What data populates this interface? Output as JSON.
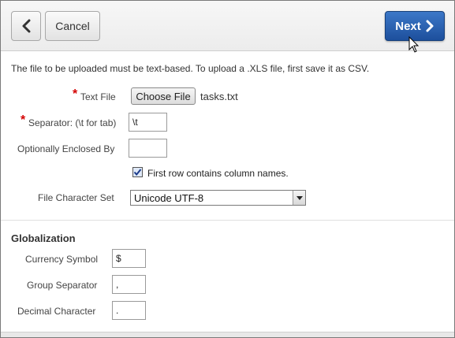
{
  "toolbar": {
    "back_icon": "chevron-left-icon",
    "cancel_label": "Cancel",
    "next_label": "Next",
    "next_icon": "chevron-right-icon",
    "accent_color": "#1d4f9c"
  },
  "info_text": "The file to be uploaded must be text-based. To upload a .XLS file, first save it as CSV.",
  "form": {
    "text_file_label": "Text File",
    "choose_file_label": "Choose File",
    "file_name": "tasks.txt",
    "separator_label": "Separator: (\\t for tab)",
    "separator_value": "\\t",
    "enclosed_label": "Optionally Enclosed By",
    "enclosed_value": "",
    "first_row_label": "First row contains column names.",
    "first_row_checked": true,
    "charset_label": "File Character Set",
    "charset_value": "Unicode UTF-8"
  },
  "globalization": {
    "title": "Globalization",
    "currency_label": "Currency Symbol",
    "currency_value": "$",
    "group_label": "Group Separator",
    "group_value": ",",
    "decimal_label": "Decimal Character",
    "decimal_value": "."
  },
  "required_color": "#d40000"
}
